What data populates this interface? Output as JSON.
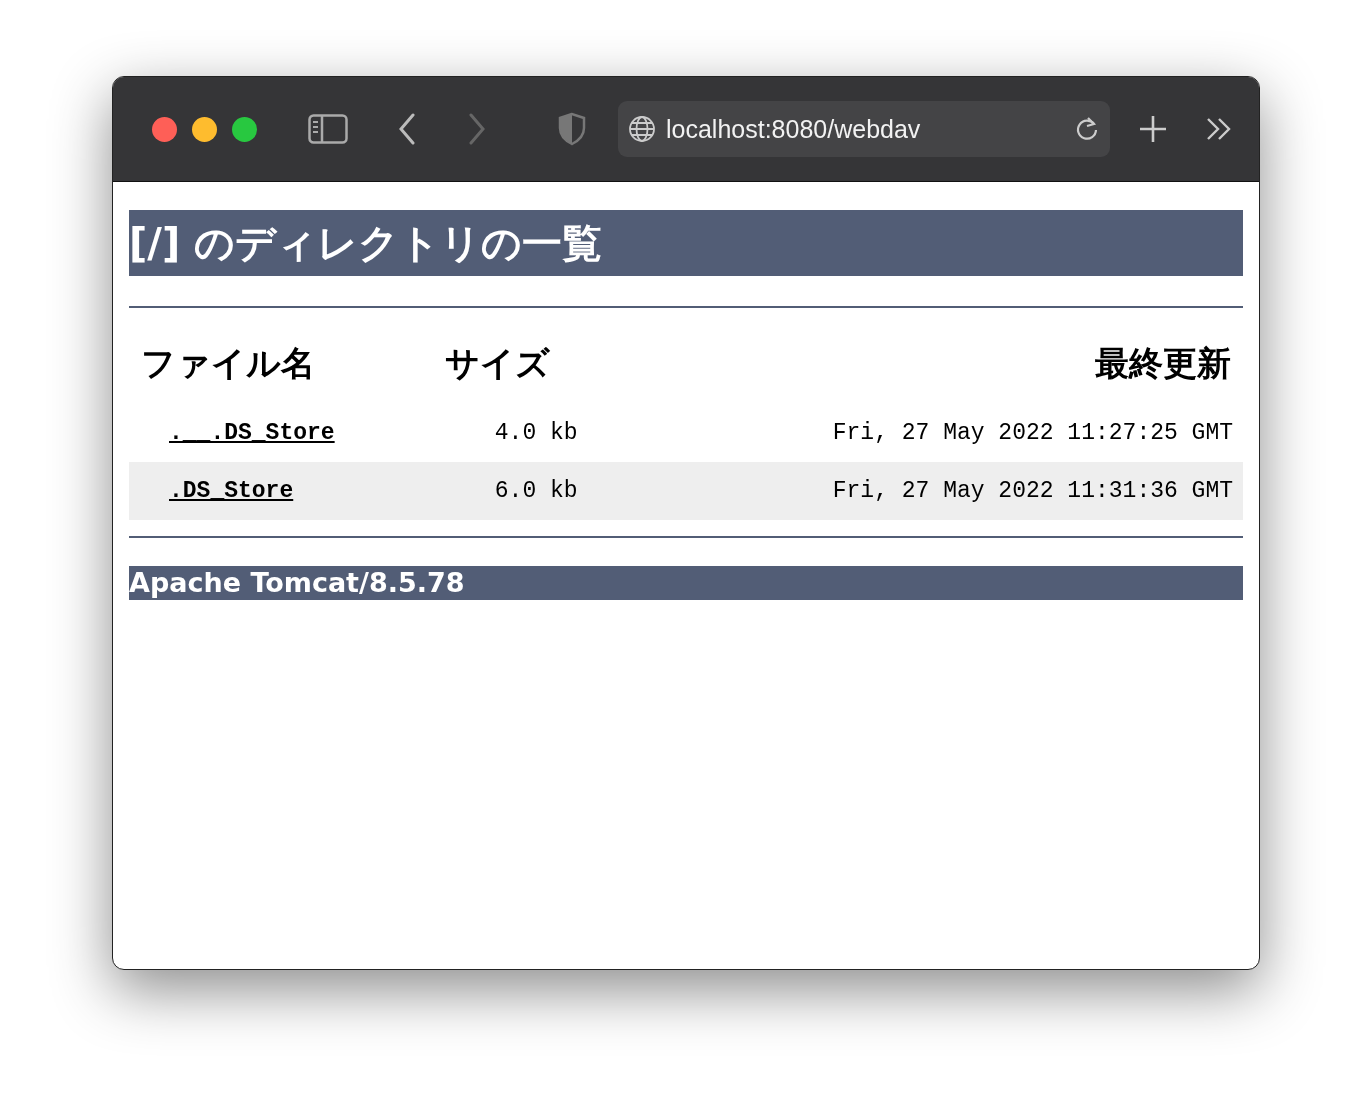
{
  "browser": {
    "address": "localhost:8080/webdav"
  },
  "page": {
    "heading": "[/] のディレクトリの一覧",
    "columns": [
      "ファイル名",
      "サイズ",
      "最終更新"
    ],
    "rows": [
      {
        "name": ".__.DS_Store",
        "size": "4.0 kb",
        "modified": "Fri, 27 May 2022 11:27:25 GMT"
      },
      {
        "name": ".DS_Store",
        "size": "6.0 kb",
        "modified": "Fri, 27 May 2022 11:31:36 GMT"
      }
    ],
    "footer": "Apache Tomcat/8.5.78"
  }
}
